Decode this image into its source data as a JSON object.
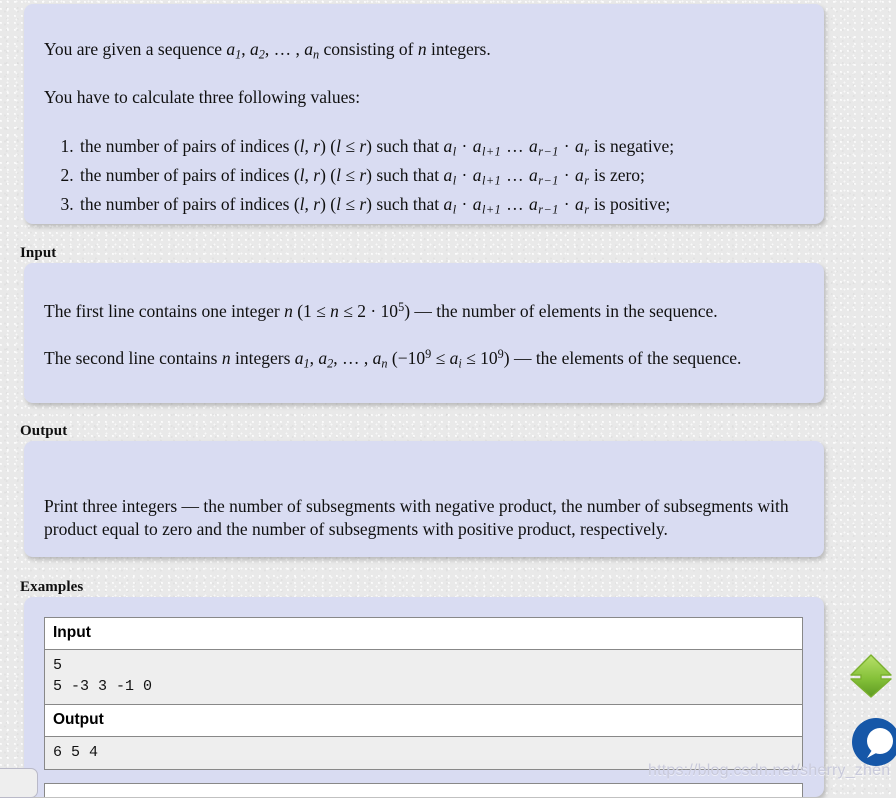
{
  "statement": {
    "intro_prefix": "You are given a sequence ",
    "seq_a1": "a",
    "seq_sub1": "1",
    "seq_a2": "a",
    "seq_sub2": "2",
    "seq_ellipsis": ", … , ",
    "seq_an": "a",
    "seq_subn": "n",
    "intro_suffix": " consisting of ",
    "intro_n": "n",
    "intro_end": " integers.",
    "calc_line": "You have to calculate three following values:",
    "claims": [
      {
        "lead": "the number of pairs of indices (",
        "l": "l",
        "comma": ", ",
        "r": "r",
        "mid": ") (",
        "cond_l": "l",
        "leq": " ≤ ",
        "cond_r": "r",
        "such": ") such that ",
        "prod": "a_l · a_{l+1} … a_{r−1} · a_r",
        "tail": " is negative;"
      },
      {
        "lead": "the number of pairs of indices (",
        "l": "l",
        "comma": ", ",
        "r": "r",
        "mid": ") (",
        "cond_l": "l",
        "leq": " ≤ ",
        "cond_r": "r",
        "such": ") such that ",
        "prod": "a_l · a_{l+1} … a_{r−1} · a_r",
        "tail": " is zero;"
      },
      {
        "lead": "the number of pairs of indices (",
        "l": "l",
        "comma": ", ",
        "r": "r",
        "mid": ") (",
        "cond_l": "l",
        "leq": " ≤ ",
        "cond_r": "r",
        "such": ") such that ",
        "prod": "a_l · a_{l+1} … a_{r−1} · a_r",
        "tail": " is positive;"
      }
    ]
  },
  "input_section": {
    "title": "Input",
    "line1": {
      "prefix": "The first line contains one integer ",
      "var": "n",
      "open": " (1 ≤ ",
      "var2": "n",
      "mid": " ≤ 2 · 10",
      "exp": "5",
      "close": ")",
      "suffix": " — the number of elements in the sequence."
    },
    "line2": {
      "prefix": "The second line contains ",
      "var": "n",
      "mid1": " integers ",
      "a": "a",
      "s1": "1",
      "s2": "2",
      "sn": "n",
      "open": " (−10",
      "exp1": "9",
      "le1": " ≤ ",
      "ai": "a",
      "aisub": "i",
      "le2": " ≤ 10",
      "exp2": "9",
      "close": ")",
      "suffix": " — the elements of the sequence."
    }
  },
  "output_section": {
    "title": "Output",
    "text": "Print three integers — the number of subsegments with negative product, the number of subsegments with product equal to zero and the number of subsegments with positive product, respectively."
  },
  "examples_section": {
    "title": "Examples",
    "table": {
      "input_header": "Input",
      "input_value": "5\n5 -3 3 -1 0",
      "output_header": "Output",
      "output_value": "6 5 4"
    }
  },
  "watermark": {
    "text": "https://blog.csdn.net/sherry_zhen"
  },
  "float_icons": {
    "scroll_top": "scroll-to-top-arrow-icon",
    "chat": "chat-bubble-icon"
  },
  "colors": {
    "panel_bg": "#d9dcf2",
    "page_bg": "#e9e9e9",
    "cell_bg": "#eeeeee",
    "border": "#888888",
    "arrow_green": "#8cc63f",
    "chat_blue": "#1657a8",
    "watermark": "#c9cadb"
  }
}
